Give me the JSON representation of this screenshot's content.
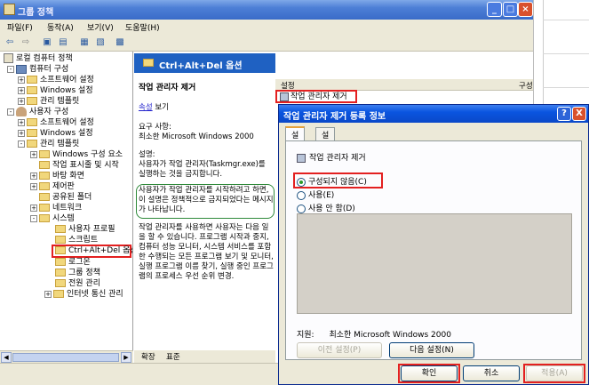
{
  "window": {
    "title": "그룹 정책"
  },
  "menu": [
    "파일(F)",
    "동작(A)",
    "보기(V)",
    "도움말(H)"
  ],
  "tree": {
    "root": "로컬 컴퓨터 정책",
    "computer_config": "컴퓨터 구성",
    "cc_software": "소프트웨어 설정",
    "cc_windows": "Windows 설정",
    "cc_admin": "관리 템플릿",
    "user_config": "사용자 구성",
    "uc_software": "소프트웨어 설정",
    "uc_windows": "Windows 설정",
    "uc_admin": "관리 템플릿",
    "win_components": "Windows 구성 요소",
    "start_taskbar": "작업 표시줄 및 시작",
    "desktop": "바탕 화면",
    "control_panel": "제어판",
    "shared_folders": "공유된 폴더",
    "network": "네트워크",
    "system": "시스템",
    "user_profiles": "사용자 프로필",
    "scripts": "스크립트",
    "ctrl_alt_del": "Ctrl+Alt+Del 옵션",
    "logon": "로그온",
    "group_policy": "그룹 정책",
    "power_mgmt": "전원 관리",
    "internet_comm": "인터넷 통신 관리"
  },
  "middle": {
    "header": "Ctrl+Alt+Del 옵션",
    "policy_title": "작업 관리자 제거",
    "props_link": "속성",
    "props_suffix": "보기",
    "req_label": "요구 사항:",
    "req_value": "최소한 Microsoft Windows 2000",
    "desc_label": "설명:",
    "desc_1": "사용자가 작업 관리자(Taskmgr.exe)를 실행하는 것을 금지합니다.",
    "desc_2": "사용자가 작업 관리자를 시작하려고 하면, 이 설명은 정책적으로 금지되었다는 메시지가 나타납니다.",
    "desc_3": "작업 관리자를 사용하면 사용자는 다음 일을 할 수 있습니다. 프로그램 시작과 중지, 컴퓨터 성능 모니터, 시스템 서비스를 포함한 수행되는 모든 프로그램 보기 및 모니터, 실행 프로그램 이름 찾기, 실행 중인 프로그램의 프로세스 우선 순위 변경."
  },
  "bottom_tabs": [
    "확장",
    "표준"
  ],
  "list": {
    "col_setting": "설정",
    "col_state": "구성",
    "row": "작업 관리자 제거"
  },
  "dialog": {
    "title": "작업 관리자 제거 등록 정보",
    "help": "?",
    "close": "X",
    "tabs": [
      "설정",
      "설명"
    ],
    "policy_name": "작업 관리자 제거",
    "radio_not_configured": "구성되지 않음(C)",
    "radio_enabled": "사용(E)",
    "radio_disabled": "사용 안 함(D)",
    "supported_label": "지원:",
    "supported_value": "최소한 Microsoft Windows 2000",
    "prev_btn": "이전 설정(P)",
    "next_btn": "다음 설정(N)",
    "ok_btn": "확인",
    "cancel_btn": "취소",
    "apply_btn": "적용(A)"
  },
  "colors": {
    "highlight_red": "#e32020",
    "green_annotation": "#2f8a3a",
    "xp_blue": "#0a55e0"
  }
}
